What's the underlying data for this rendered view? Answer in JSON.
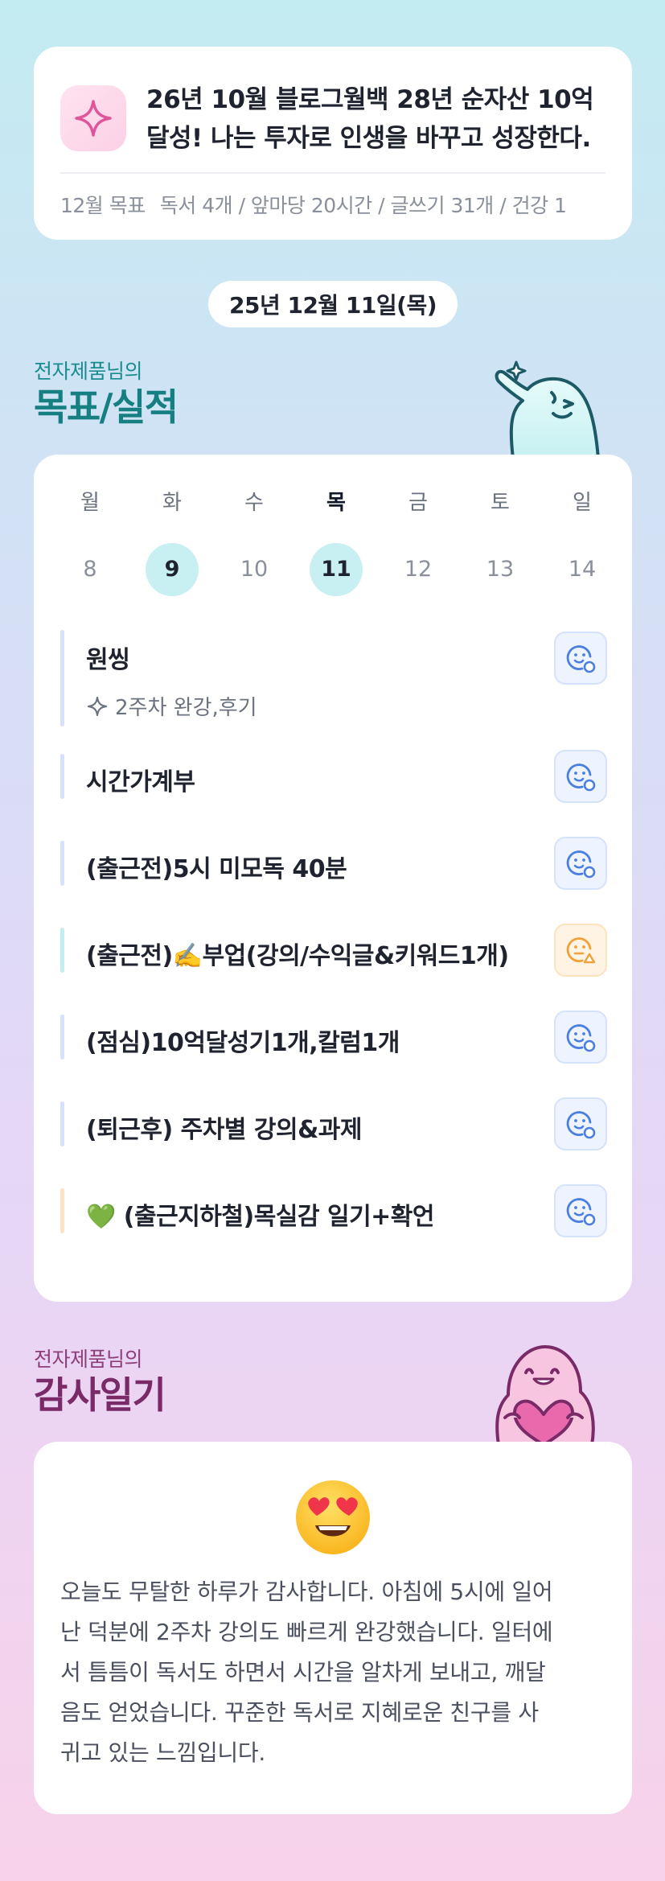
{
  "goal": {
    "icon": "sparkle-icon",
    "line1": "26년 10월 블로그월백 28년 순자산 10억",
    "line2": "달성! 나는 투자로 인생을 바꾸고 성장한다.",
    "monthly_label": "12월 목표",
    "monthly_value": "독서 4개 / 앞마당 20시간 / 글쓰기 31개 / 건강 1"
  },
  "date": "25년 12월 11일(목)",
  "goals_section": {
    "subtitle": "전자제품님의",
    "title": "목표/실적"
  },
  "week": {
    "days": [
      {
        "name": "월",
        "num": "8",
        "done": false,
        "today": false
      },
      {
        "name": "화",
        "num": "9",
        "done": true,
        "today": false
      },
      {
        "name": "수",
        "num": "10",
        "done": false,
        "today": false
      },
      {
        "name": "목",
        "num": "11",
        "done": true,
        "today": true
      },
      {
        "name": "금",
        "num": "12",
        "done": false,
        "today": false
      },
      {
        "name": "토",
        "num": "13",
        "done": false,
        "today": false
      },
      {
        "name": "일",
        "num": "14",
        "done": false,
        "today": false
      }
    ]
  },
  "tasks": [
    {
      "label": "원씽",
      "sub": "2주차 완강,후기",
      "bar_color": "#d6e2fb",
      "status": "blue",
      "status_icon": "smiley-check-icon"
    },
    {
      "label": "시간가계부",
      "bar_color": "#d6e2fb",
      "status": "blue",
      "status_icon": "smiley-check-icon"
    },
    {
      "label": "(출근전)5시 미모독 40분",
      "bar_color": "#d6e2fb",
      "status": "blue",
      "status_icon": "smiley-check-icon"
    },
    {
      "label": "(출근전)✍️부업(강의/수익글&키워드1개)",
      "bar_color": "#c5eef0",
      "status": "orange",
      "status_icon": "smiley-warning-icon"
    },
    {
      "label": "(점심)10억달성기1개,칼럼1개",
      "bar_color": "#d6e2fb",
      "status": "blue",
      "status_icon": "smiley-check-icon"
    },
    {
      "label": "(퇴근후) 주차별 강의&과제",
      "bar_color": "#d6e2fb",
      "status": "blue",
      "status_icon": "smiley-check-icon"
    },
    {
      "label": "💚 (출근지하철)목실감 일기+확언",
      "bar_color": "#fde3c4",
      "status": "blue",
      "status_icon": "smiley-check-icon"
    }
  ],
  "gratitude_section": {
    "subtitle": "전자제품님의",
    "title": "감사일기"
  },
  "gratitude": {
    "emoji": "heart-eyes-emoji",
    "lines": [
      "오늘도 무탈한 하루가 감사합니다. 아침에 5시에 일어",
      "난 덕분에 2주차 강의도 빠르게 완강했습니다. 일터에",
      "서 틈틈이 독서도 하면서 시간을 알차게 보내고, 깨달",
      "음도 얻었습니다. 꾸준한 독서로 지혜로운 친구를 사",
      "귀고 있는 느낌입니다."
    ]
  },
  "colors": {
    "teal_title": "#157f82",
    "plum_title": "#7a2b67",
    "status_blue": "#4a7fe0",
    "status_orange": "#f0a13a"
  }
}
